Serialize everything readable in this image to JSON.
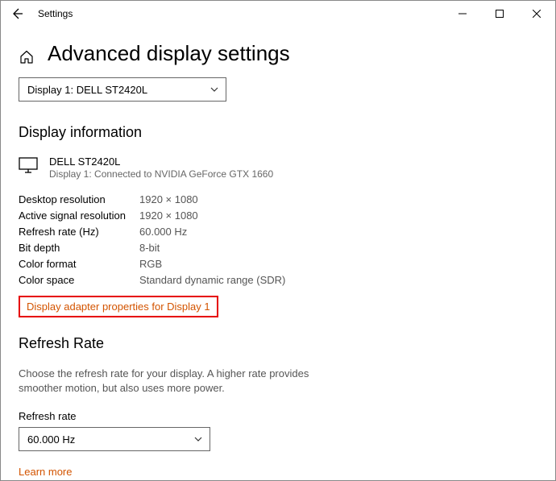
{
  "window": {
    "title": "Settings"
  },
  "page": {
    "title": "Advanced display settings"
  },
  "displaySelector": {
    "selected": "Display 1: DELL ST2420L"
  },
  "displayInfo": {
    "sectionTitle": "Display information",
    "monitorName": "DELL ST2420L",
    "connection": "Display 1: Connected to NVIDIA GeForce GTX 1660",
    "rows": [
      {
        "label": "Desktop resolution",
        "value": "1920 × 1080"
      },
      {
        "label": "Active signal resolution",
        "value": "1920 × 1080"
      },
      {
        "label": "Refresh rate (Hz)",
        "value": "60.000 Hz"
      },
      {
        "label": "Bit depth",
        "value": "8-bit"
      },
      {
        "label": "Color format",
        "value": "RGB"
      },
      {
        "label": "Color space",
        "value": "Standard dynamic range (SDR)"
      }
    ],
    "adapterLink": "Display adapter properties for Display 1"
  },
  "refreshRate": {
    "sectionTitle": "Refresh Rate",
    "description": "Choose the refresh rate for your display. A higher rate provides smoother motion, but also uses more power.",
    "label": "Refresh rate",
    "selected": "60.000 Hz",
    "learnMore": "Learn more"
  }
}
